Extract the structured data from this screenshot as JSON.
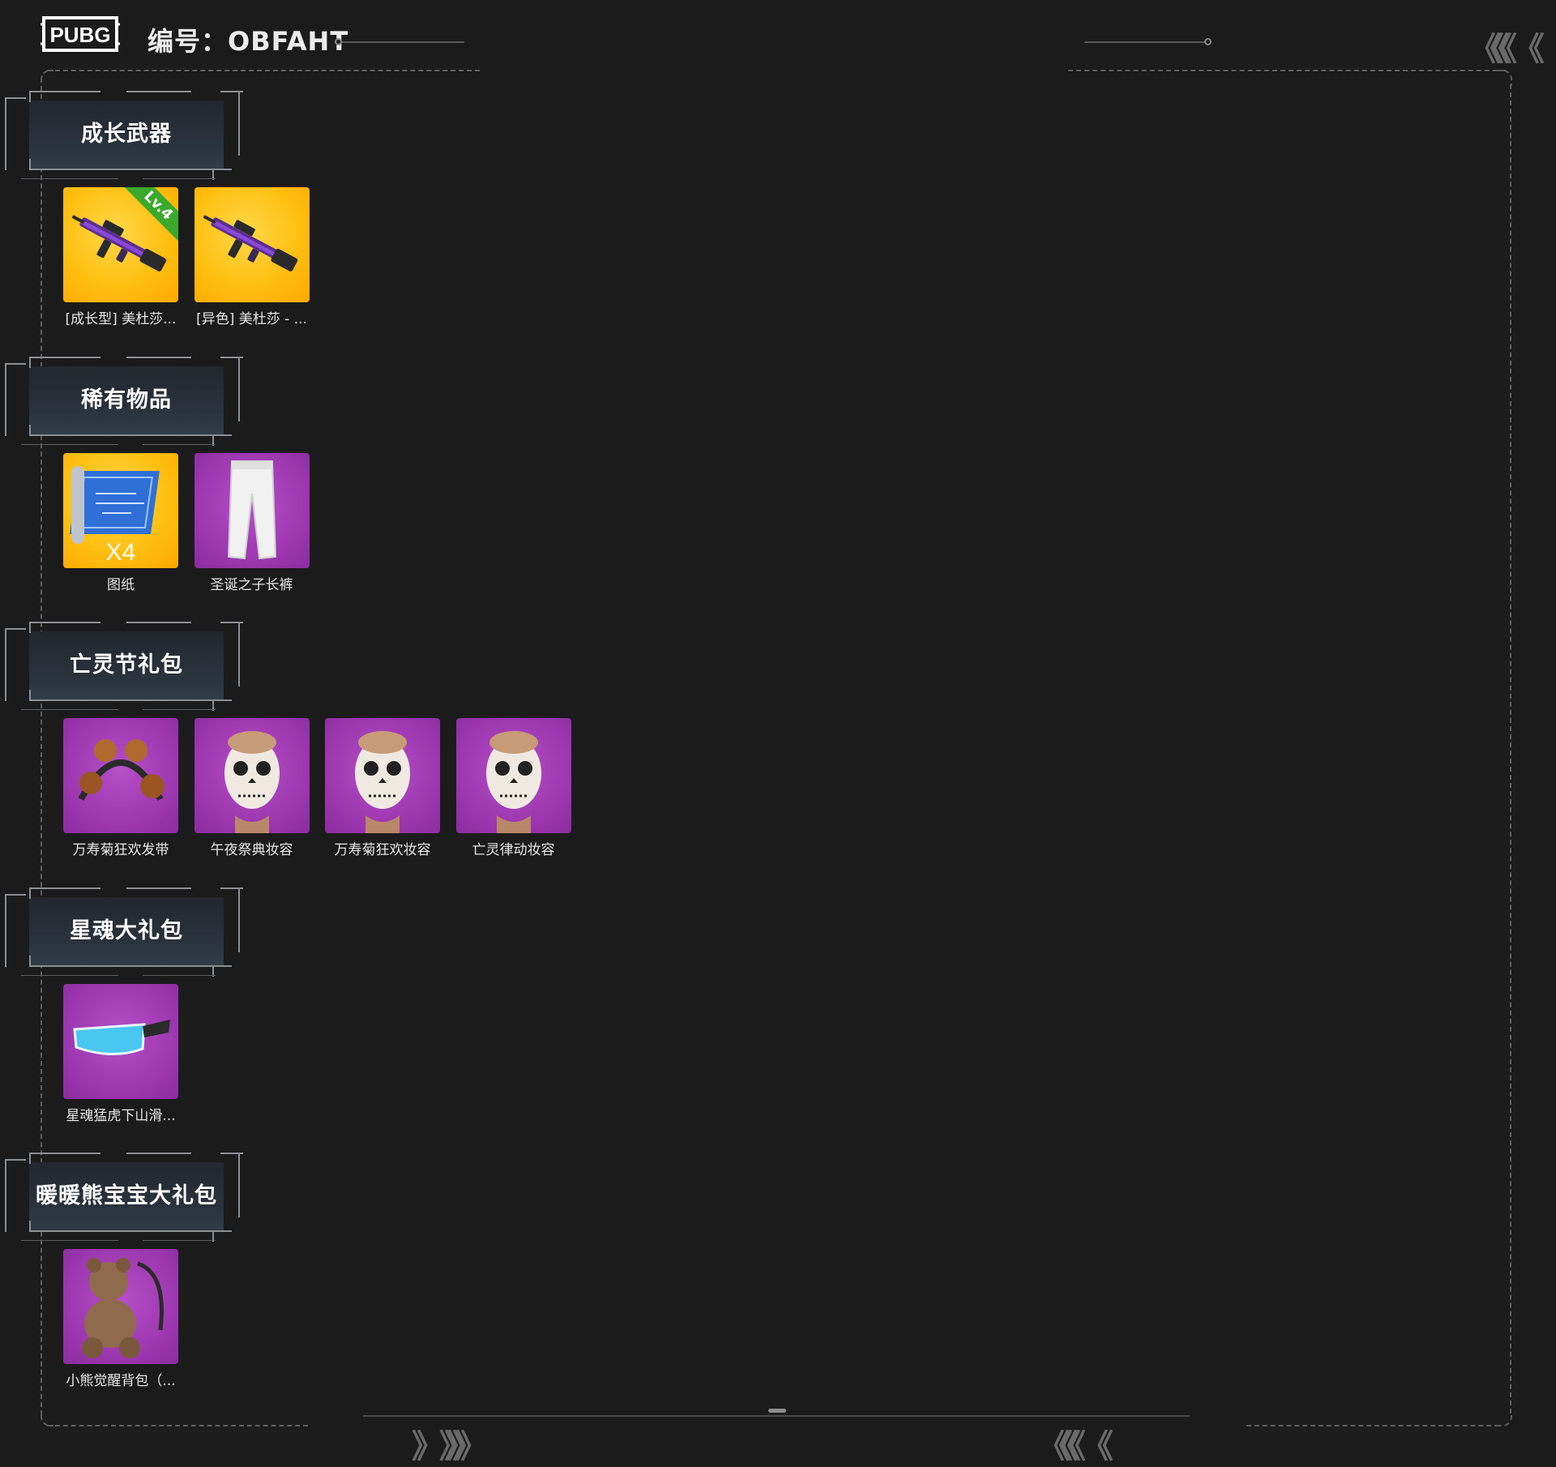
{
  "header": {
    "logo_text": "PUBG",
    "code_label": "编号：OBFAHT"
  },
  "sections": [
    {
      "title": "成长武器",
      "items": [
        {
          "name": "[成长型] 美杜莎...",
          "badge": "Lv.4",
          "rarity": "gold",
          "icon": "rifle-icon"
        },
        {
          "name": "[异色] 美杜莎 - ...",
          "rarity": "gold",
          "icon": "rifle-icon"
        }
      ]
    },
    {
      "title": "稀有物品",
      "items": [
        {
          "name": "图纸",
          "quantity": "X4",
          "rarity": "gold",
          "icon": "blueprint-icon"
        },
        {
          "name": "圣诞之子长裤",
          "rarity": "purple",
          "icon": "pants-icon"
        }
      ]
    },
    {
      "title": "亡灵节礼包",
      "items": [
        {
          "name": "万寿菊狂欢发带",
          "rarity": "purple",
          "icon": "headband-icon"
        },
        {
          "name": "午夜祭典妆容",
          "rarity": "purple",
          "icon": "face-paint-icon"
        },
        {
          "name": "万寿菊狂欢妆容",
          "rarity": "purple",
          "icon": "face-paint-icon"
        },
        {
          "name": "亡灵律动妆容",
          "rarity": "purple",
          "icon": "face-paint-icon"
        }
      ]
    },
    {
      "title": "星魂大礼包",
      "items": [
        {
          "name": "星魂猛虎下山滑...",
          "rarity": "purple",
          "icon": "goggles-icon"
        }
      ]
    },
    {
      "title": "暖暖熊宝宝大礼包",
      "items": [
        {
          "name": "小熊觉醒背包（...",
          "rarity": "purple",
          "icon": "teddy-bear-backpack-icon"
        }
      ]
    }
  ],
  "colors": {
    "background": "#1b1b1c",
    "gold": "#ffc012",
    "purple": "#9a35ad"
  }
}
